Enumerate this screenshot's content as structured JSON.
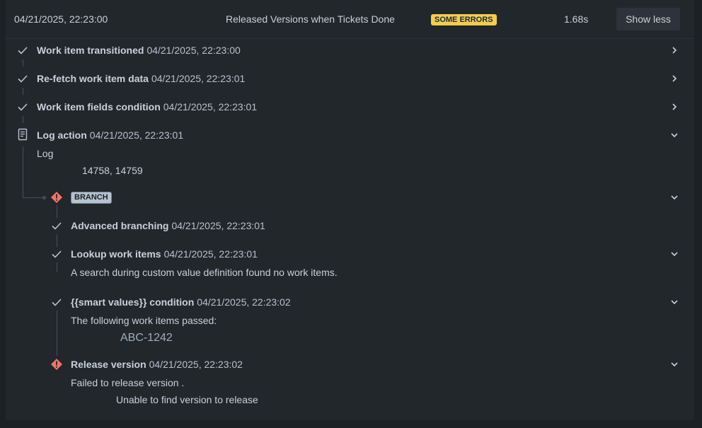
{
  "header": {
    "date": "04/21/2025, 22:23:00",
    "title": "Released Versions when Tickets Done",
    "status_badge": "SOME ERRORS",
    "duration": "1.68s",
    "toggle_label": "Show less"
  },
  "steps": [
    {
      "title": "Work item transitioned",
      "time": "04/21/2025, 22:23:00",
      "status": "success",
      "expanded": false
    },
    {
      "title": "Re-fetch work item data",
      "time": "04/21/2025, 22:23:01",
      "status": "success",
      "expanded": false
    },
    {
      "title": "Work item fields condition",
      "time": "04/21/2025, 22:23:01",
      "status": "success",
      "expanded": false
    },
    {
      "title": "Log action",
      "time": "04/21/2025, 22:23:01",
      "status": "log",
      "expanded": true,
      "details": {
        "label": "Log",
        "value": "14758, 14759"
      }
    }
  ],
  "branch": {
    "label": "BRANCH",
    "status": "error",
    "steps": [
      {
        "title": "Advanced branching",
        "time": "04/21/2025, 22:23:01",
        "status": "success"
      },
      {
        "title": "Lookup work items",
        "time": "04/21/2025, 22:23:01",
        "status": "success",
        "message": "A search during custom value definition found no work items."
      },
      {
        "title": "{{smart values}} condition",
        "time": "04/21/2025, 22:23:02",
        "status": "success",
        "message": "The following work items passed:",
        "items": [
          "ABC-1242"
        ]
      },
      {
        "title": "Release version",
        "time": "04/21/2025, 22:23:02",
        "status": "error",
        "message": "Failed to release version .",
        "detail": "Unable to find version to release"
      }
    ]
  },
  "colors": {
    "background": "#1d2125",
    "panel": "#22272b",
    "warning_badge": "#f5cd47",
    "error_icon": "#f87168",
    "connector": "#454f59"
  }
}
